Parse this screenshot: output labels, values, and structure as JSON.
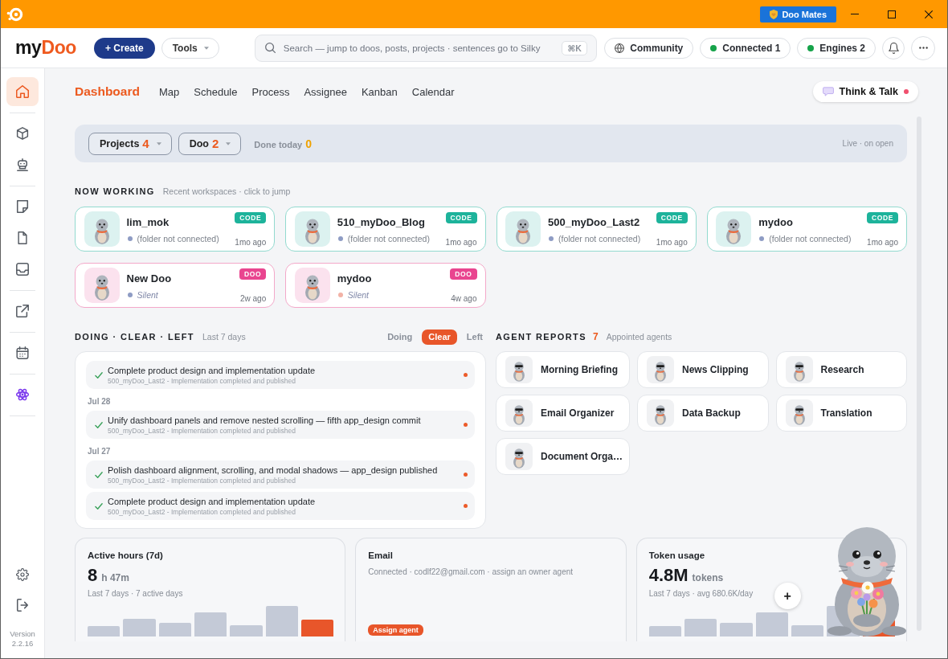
{
  "titlebar": {
    "button": "Doo Mates"
  },
  "header": {
    "logo": {
      "prefix": "my",
      "accent": "Doo"
    },
    "create_button": "+ Create",
    "tools_button": "Tools",
    "search": {
      "placeholder": "Search — jump to doos, posts, projects · sentences go to Silky",
      "shortcut": "⌘K"
    },
    "pills": [
      {
        "kind": "link",
        "label": "Community"
      },
      {
        "kind": "status",
        "label": "Connected 1",
        "color": "#16a34a"
      },
      {
        "kind": "status",
        "label": "Engines 2",
        "color": "#16a34a"
      }
    ]
  },
  "sidebar": {
    "groups": [
      {
        "items": [
          {
            "kind": "home",
            "selected": true
          }
        ]
      },
      {
        "items": [
          {
            "kind": "cube",
            "selected": false
          },
          {
            "kind": "robot",
            "selected": false
          }
        ]
      },
      {
        "items": [
          {
            "kind": "note",
            "selected": false
          },
          {
            "kind": "file",
            "selected": false
          },
          {
            "kind": "inbox",
            "selected": false
          }
        ]
      },
      {
        "items": [
          {
            "kind": "external",
            "selected": false
          }
        ]
      },
      {
        "items": [
          {
            "kind": "calendar",
            "selected": false
          }
        ]
      },
      {
        "items": [
          {
            "kind": "atom",
            "selected": false
          }
        ]
      }
    ],
    "footer": [
      {
        "kind": "settings"
      },
      {
        "kind": "logout"
      }
    ],
    "version": "Version 2.2.16"
  },
  "tabs": [
    {
      "label": "Dashboard",
      "selected": true
    },
    {
      "label": "Map",
      "selected": false
    },
    {
      "label": "Schedule",
      "selected": false
    },
    {
      "label": "Process",
      "selected": false
    },
    {
      "label": "Assignee",
      "selected": false
    },
    {
      "label": "Kanban",
      "selected": false
    },
    {
      "label": "Calendar",
      "selected": false
    }
  ],
  "think_talk": {
    "label": "Think & Talk",
    "unread": true
  },
  "summary": {
    "filters": [
      {
        "label": "Projects",
        "count": "4"
      },
      {
        "label": "Doo",
        "count": "2"
      }
    ],
    "done_today": {
      "label": "Done today",
      "count": "0"
    },
    "live_note": "Live · on open"
  },
  "now_working": {
    "title": "NOW WORKING",
    "subtitle": "Recent workspaces · click to jump",
    "cards": [
      {
        "kind": "code",
        "name": "lim_mok",
        "badge": "CODE",
        "status": "(folder not connected)",
        "color": "#8e9cc4",
        "time": "1mo ago"
      },
      {
        "kind": "code",
        "name": "510_myDoo_Blog",
        "badge": "CODE",
        "status": "(folder not connected)",
        "color": "#8e9cc4",
        "time": "1mo ago"
      },
      {
        "kind": "code",
        "name": "500_myDoo_Last2",
        "badge": "CODE",
        "status": "(folder not connected)",
        "color": "#8e9cc4",
        "time": "1mo ago"
      },
      {
        "kind": "code",
        "name": "mydoo",
        "badge": "CODE",
        "status": "(folder not connected)",
        "color": "#8e9cc4",
        "time": "1mo ago"
      },
      {
        "kind": "doo",
        "name": "New Doo",
        "badge": "DOO",
        "status": "Silent",
        "color": "#8e9cc4",
        "time": "2w ago"
      },
      {
        "kind": "doo",
        "name": "mydoo",
        "badge": "DOO",
        "status": "Silent",
        "color": "#f2b2a6",
        "time": "4w ago"
      }
    ]
  },
  "activity": {
    "title": "DOING · CLEAR · LEFT",
    "subtitle": "Last 7 days",
    "filters": [
      {
        "label": "Doing",
        "selected": false
      },
      {
        "label": "Clear",
        "selected": true
      },
      {
        "label": "Left",
        "selected": false
      }
    ],
    "groups": [
      {
        "items": [
          {
            "title": "Complete product design and implementation update",
            "detail": "500_myDoo_Last2 - Implementation completed and published",
            "done": true
          }
        ]
      },
      {
        "date": "Jul 28",
        "items": [
          {
            "title": "Unify dashboard panels and remove nested scrolling — fifth app_design commit",
            "detail": "500_myDoo_Last2 - Implementation completed and published",
            "done": true
          }
        ]
      },
      {
        "date": "Jul 27",
        "items": [
          {
            "title": "Polish dashboard alignment, scrolling, and modal shadows — app_design published",
            "detail": "500_myDoo_Last2 - Implementation completed and published",
            "done": true
          },
          {
            "title": "Complete product design and implementation update",
            "detail": "500_myDoo_Last2 - Implementation completed and published",
            "done": true
          }
        ]
      }
    ]
  },
  "agent_reports": {
    "title": "AGENT REPORTS",
    "count": "7",
    "subtitle": "Appointed agents",
    "items": [
      {
        "name": "Morning Briefing"
      },
      {
        "name": "News Clipping"
      },
      {
        "name": "Research"
      },
      {
        "name": "Email Organizer"
      },
      {
        "name": "Data Backup"
      },
      {
        "name": "Translation"
      },
      {
        "name": "Document Orga…"
      }
    ]
  },
  "stats": [
    {
      "kind": "metric",
      "title": "Active hours (7d)",
      "value": "8",
      "unit": "h 47m",
      "note": "Last 7 days · 7 active days"
    },
    {
      "kind": "email",
      "title": "Email",
      "note": "Connected · codlf22@gmail.com · assign an owner agent",
      "action": "Assign agent"
    },
    {
      "kind": "metric",
      "title": "Token usage",
      "value": "4.8M",
      "unit": "tokens",
      "note": "Last 7 days · avg 680.6K/day",
      "add_button": "+"
    }
  ]
}
